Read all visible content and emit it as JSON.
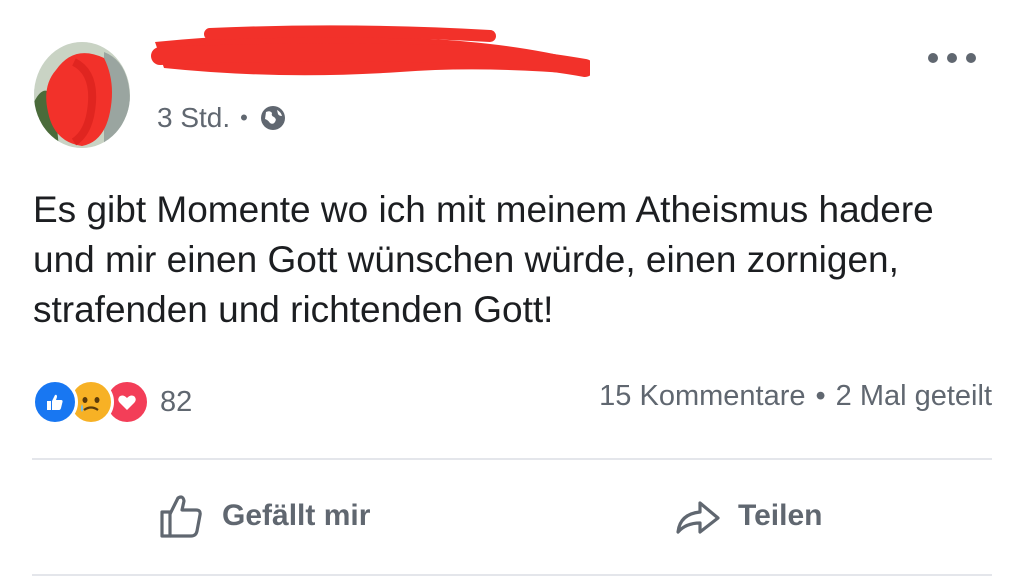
{
  "header": {
    "timestamp": "3 Std.",
    "separator": "•",
    "privacy_icon": "globe-icon",
    "more_icon": "more-icon"
  },
  "post": {
    "text": "Es gibt Momente wo ich mit meinem Atheismus hadere und mir einen Gott wünschen würde, einen zornigen, strafenden und richtenden Gott!"
  },
  "reactions": {
    "icons": [
      "like-icon",
      "sad-icon",
      "love-icon"
    ],
    "count": "82",
    "comments": "15 Kommentare",
    "separator": "•",
    "shares": "2 Mal geteilt"
  },
  "actions": {
    "like_label": "Gefällt mir",
    "share_label": "Teilen"
  },
  "colors": {
    "redaction": "#f2312a",
    "like_blue": "#1877f2",
    "love_red": "#f33e58",
    "sad_yellow": "#f7b125",
    "secondary_text": "#606770"
  }
}
